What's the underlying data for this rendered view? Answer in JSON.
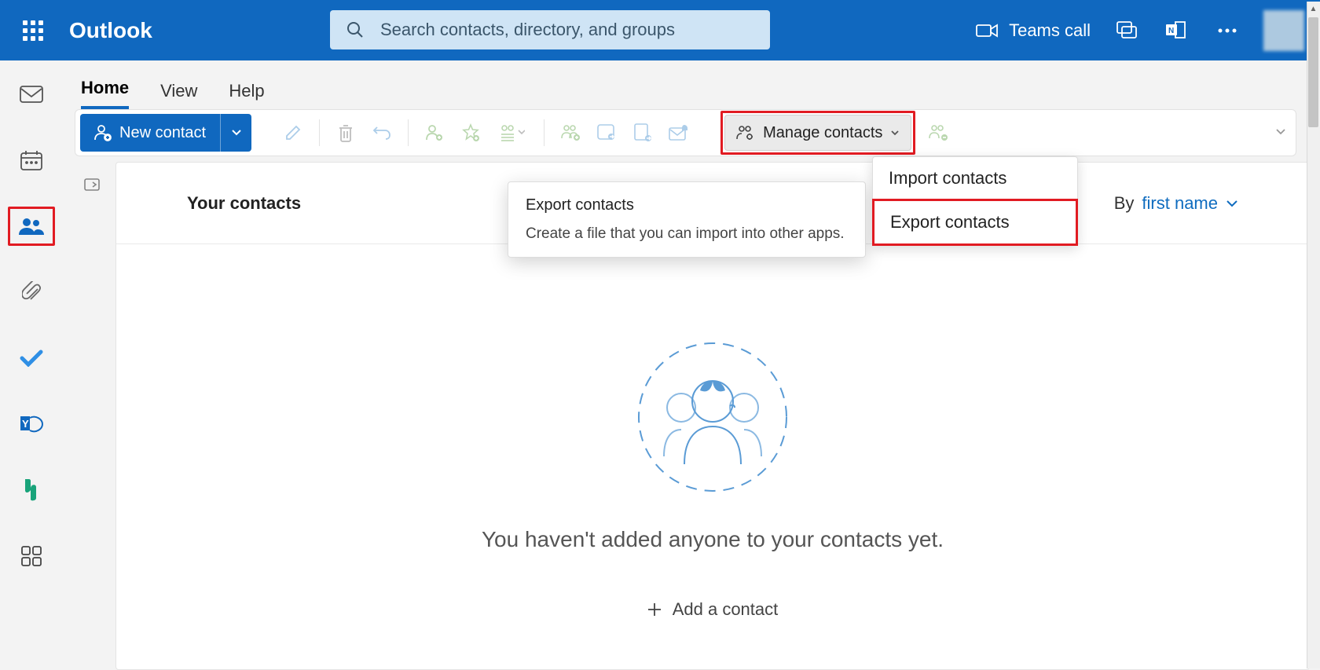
{
  "header": {
    "app_title": "Outlook",
    "search_placeholder": "Search contacts, directory, and groups",
    "teams_call": "Teams call"
  },
  "tabs": {
    "home": "Home",
    "view": "View",
    "help": "Help"
  },
  "toolbar": {
    "new_contact": "New contact",
    "manage_contacts": "Manage contacts"
  },
  "content": {
    "title": "Your contacts",
    "sort_label_prefix": "By ",
    "sort_label": "first name",
    "empty_heading": "You haven't added anyone to your contacts yet.",
    "add_contact": "Add a contact"
  },
  "dropdown": {
    "import": "Import contacts",
    "export": "Export contacts"
  },
  "tooltip": {
    "title": "Export contacts",
    "desc": "Create a file that you can import into other apps."
  }
}
